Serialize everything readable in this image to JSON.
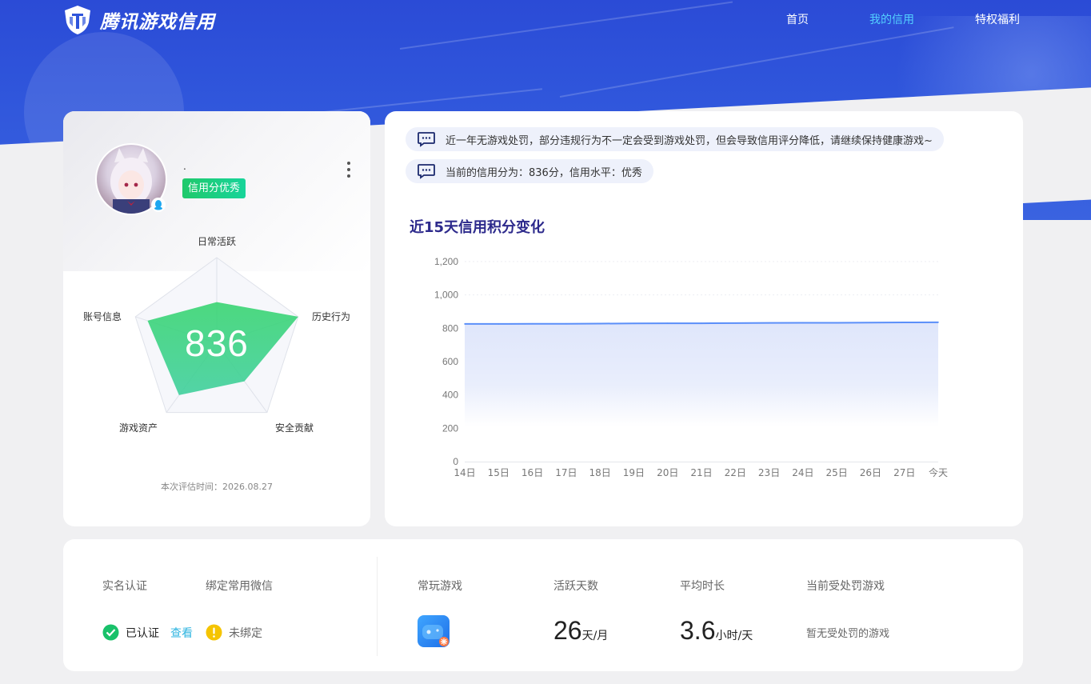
{
  "header": {
    "logo_text": "腾讯游戏信用",
    "nav": [
      {
        "label": "首页",
        "active": false
      },
      {
        "label": "我的信用",
        "active": true
      },
      {
        "label": "特权福利",
        "active": false
      }
    ]
  },
  "profile": {
    "nickname": ".",
    "credit_tag": "信用分优秀",
    "score": "836",
    "radar_labels": [
      "日常活跃",
      "历史行为",
      "安全贡献",
      "游戏资产",
      "账号信息"
    ],
    "radar_values": [
      0.48,
      1.0,
      0.55,
      0.75,
      0.85
    ],
    "eval_time": "本次评估时间：2026.08.27"
  },
  "notices": [
    "近一年无游戏处罚，部分违规行为不一定会受到游戏处罚，但会导致信用评分降低，请继续保持健康游戏~",
    "当前的信用分为：836分，信用水平：优秀"
  ],
  "chart_title": "近15天信用积分变化",
  "chart_data": {
    "type": "area",
    "title": "近15天信用积分变化",
    "categories": [
      "14日",
      "15日",
      "16日",
      "17日",
      "18日",
      "19日",
      "20日",
      "21日",
      "22日",
      "23日",
      "24日",
      "25日",
      "26日",
      "27日",
      "今天"
    ],
    "values": [
      826,
      826,
      827,
      827,
      828,
      829,
      830,
      830,
      831,
      832,
      833,
      833,
      834,
      835,
      836
    ],
    "ylim": [
      0,
      1200
    ],
    "yticks": [
      "0",
      "200",
      "400",
      "600",
      "800",
      "1,000",
      "1,200"
    ],
    "ytick_values": [
      0,
      200,
      400,
      600,
      800,
      1000,
      1200
    ],
    "grid": true,
    "line_color": "#5b8ff9"
  },
  "bottom": {
    "realname_label": "实名认证",
    "wechat_label": "绑定常用微信",
    "realname_status": "已认证",
    "view_link": "查看",
    "wechat_status": "未绑定",
    "games_label": "常玩游戏",
    "active_label": "活跃天数",
    "active_value": "26",
    "active_unit": "天/月",
    "avg_label": "平均时长",
    "avg_value": "3.6",
    "avg_unit": "小时/天",
    "penalty_label": "当前受处罚游戏",
    "penalty_value": "暂无受处罚的游戏"
  },
  "colors": {
    "brand": "#2f55db",
    "nav_active": "#53d0ff",
    "success": "#19c16a",
    "warning": "#f5c400",
    "link": "#2fb5e0"
  }
}
